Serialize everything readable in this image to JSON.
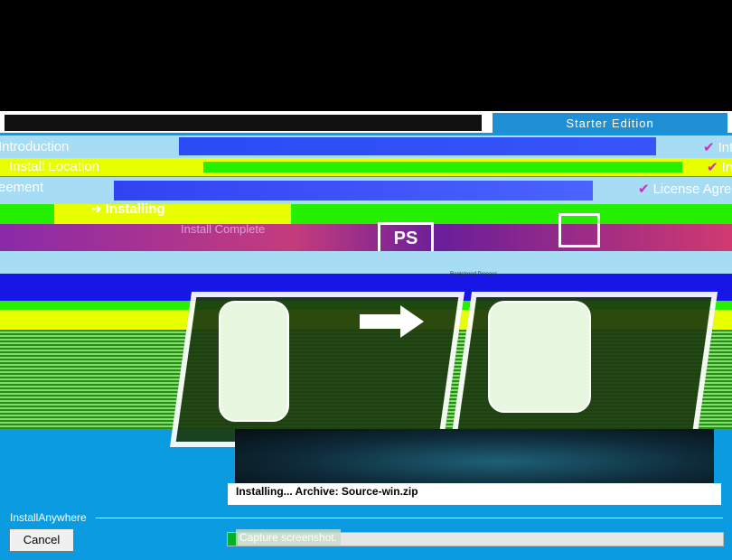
{
  "header": {
    "edition": "Starter Edition"
  },
  "steps": {
    "introduction": "Introduction",
    "introduction_right": "Int",
    "install_location": "Install Location",
    "install_location_right": "Install",
    "license_left": "eement",
    "license_right": "License Agre",
    "installing": "Installing",
    "install_complete": "Install Complete"
  },
  "illustration": {
    "app_name": "Registered Process",
    "ps_icon": "PS"
  },
  "status": {
    "text": "Installing...  Archive: Source-win.zip"
  },
  "footer": {
    "vendor": "InstallAnywhere",
    "cancel_label": "Cancel",
    "capture_tip": "Capture screenshot.",
    "progress": 0.02
  },
  "icons": {
    "check": "check-icon",
    "arrow": "arrow-right-icon"
  },
  "colors": {
    "background": "#0a9be0",
    "check": "#e020c8",
    "progress": "#06b025"
  }
}
